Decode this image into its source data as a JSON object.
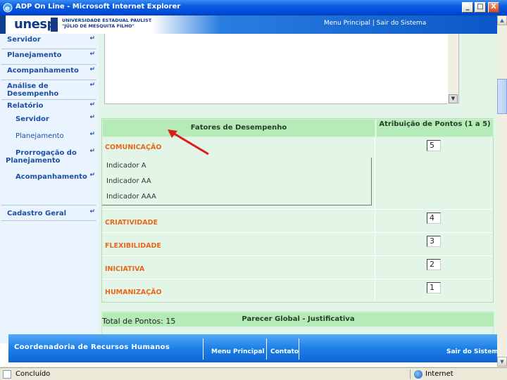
{
  "window": {
    "title": "ADP On Line - Microsoft Internet Explorer",
    "minimize": "_",
    "maximize": "□",
    "close": "X"
  },
  "banner": {
    "logo": "unesp",
    "university_line1": "UNIVERSIDADE ESTADUAL PAULISTA",
    "university_line2": "\"JÚLIO DE MESQUITA FILHO\"",
    "links": "Menu Principal | Sair do Sistema"
  },
  "sidebar": {
    "items": [
      {
        "label": "Servidor"
      },
      {
        "label": "Planejamento"
      },
      {
        "label": "Acompanhamento"
      },
      {
        "label": "Análise de Desempenho"
      },
      {
        "label": "Relatório"
      },
      {
        "label": "Servidor"
      },
      {
        "label": "Planejamento"
      },
      {
        "label": "Prorrogação do Planejamento"
      },
      {
        "label": "Acompanhamento"
      },
      {
        "label": "Cadastro Geral"
      }
    ],
    "arrow_glyph": "↵"
  },
  "table": {
    "header_factors": "Fatores de Desempenho",
    "header_points": "Atribuição de Pontos (1 a 5)",
    "rows": [
      {
        "name": "COMUNICAÇÃO",
        "points": "5"
      },
      {
        "name": "CRIATIVIDADE",
        "points": "4"
      },
      {
        "name": "FLEXIBILIDADE",
        "points": "3"
      },
      {
        "name": "INICIATIVA",
        "points": "2"
      },
      {
        "name": "HUMANIZAÇÃO",
        "points": "1"
      }
    ],
    "indicators": [
      "Indicador A",
      "Indicador AA",
      "Indicador AAA"
    ]
  },
  "parecer": {
    "title": "Parecer Global - Justificativa",
    "total": "Total de Pontos: 15"
  },
  "footer": {
    "org": "Coordenadoria de Recursos Humanos",
    "menu": "Menu Principal",
    "contato": "Contato",
    "sair": "Sair do Sistema"
  },
  "status": {
    "text": "Concluído",
    "zone": "Internet"
  },
  "colors": {
    "factor_orange": "#e8671c",
    "header_green": "#b4ebb7",
    "panel_green": "#e3f5e6",
    "arrow_red": "#e01b1b",
    "menu_blue": "#1f4fa3"
  }
}
